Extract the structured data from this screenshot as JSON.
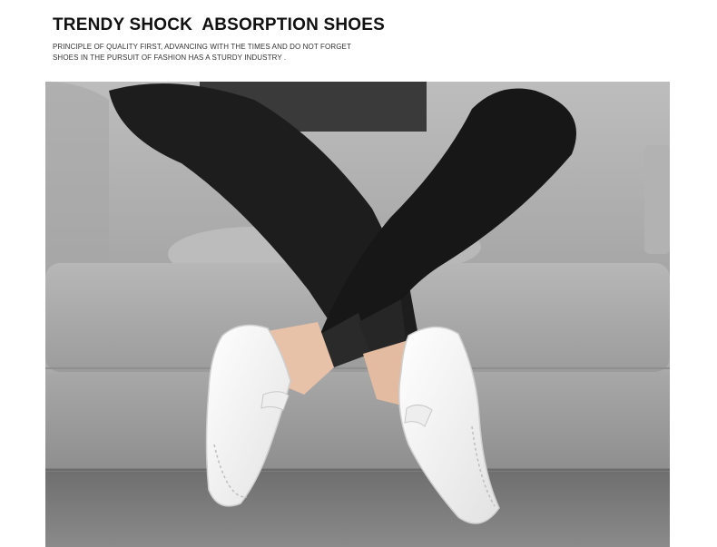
{
  "header": {
    "title": "TRENDY SHOCK  ABSORPTION SHOES",
    "subtitle_line1": "PRINCIPLE OF QUALITY FIRST, ADVANCING WITH THE TIMES AND DO NOT FORGET",
    "subtitle_line2": "SHOES IN THE PURSUIT OF FASHION HAS A STURDY INDUSTRY ."
  },
  "photo": {
    "subject": "man in black jeans wearing white leather slip-on shoes seated on grey sofa",
    "colors": {
      "sofa": "#a9a9a9",
      "floor": "#7e7e7e",
      "jeans": "#1b1b1b",
      "shoes": "#f4f4f4",
      "skin": "#e9c4ad"
    }
  }
}
